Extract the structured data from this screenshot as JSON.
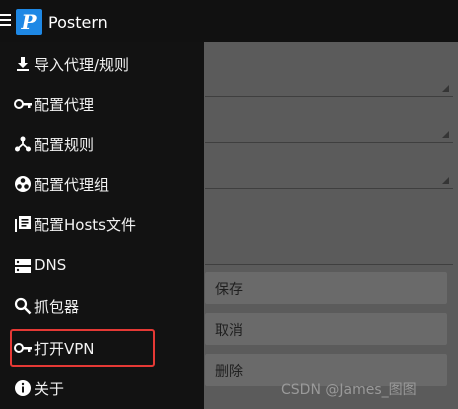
{
  "app": {
    "title": "Postern",
    "logo_letter": "P"
  },
  "drawer": {
    "items": [
      {
        "icon": "download-icon",
        "label": "导入代理/规则"
      },
      {
        "icon": "key-icon",
        "label": "配置代理"
      },
      {
        "icon": "share-icon",
        "label": "配置规则"
      },
      {
        "icon": "group-icon",
        "label": "配置代理组"
      },
      {
        "icon": "library-icon",
        "label": "配置Hosts文件"
      },
      {
        "icon": "dns-icon",
        "label": "DNS"
      },
      {
        "icon": "search-icon",
        "label": "抓包器"
      },
      {
        "icon": "key-icon",
        "label": "打开VPN"
      },
      {
        "icon": "info-icon",
        "label": "关于"
      }
    ],
    "highlighted_item": "打开VPN"
  },
  "form": {
    "buttons": {
      "save": "保存",
      "cancel": "取消",
      "delete": "删除"
    }
  },
  "watermark": "CSDN @James_图图",
  "colors": {
    "logo_blue": "#1e88e5",
    "highlight_red": "#e53935",
    "drawer_bg": "#121212"
  }
}
